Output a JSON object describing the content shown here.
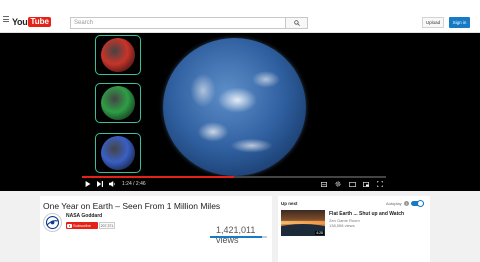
{
  "header": {
    "logo_you": "You",
    "logo_tube": "Tube",
    "search_placeholder": "Search",
    "upload_label": "Upload",
    "signin_label": "Sign in"
  },
  "player": {
    "time": "1:24 / 2:46",
    "progress": 0.5,
    "thumbnails": [
      {
        "name": "red",
        "color": "#c8342a"
      },
      {
        "name": "green",
        "color": "#2e9e46"
      },
      {
        "name": "blue",
        "color": "#3a5fc4"
      }
    ]
  },
  "video": {
    "title": "One Year on Earth – Seen From 1 Million Miles",
    "channel": "NASA Goddard",
    "subscribe_label": "Subscribe",
    "subscriber_count": "207,371",
    "views": "1,421,011 views"
  },
  "sidebar": {
    "up_next_label": "Up next",
    "autoplay_label": "Autoplay",
    "autoplay_on": true,
    "next": {
      "title": "Flat Earth ... Shut up and Watch",
      "channel": "Zen Game Room",
      "views": "138,558 views",
      "duration": "4:28"
    }
  },
  "colors": {
    "brand_red": "#e62117",
    "accent_blue": "#167ac6",
    "thumb_border": "#3bbf9c"
  }
}
